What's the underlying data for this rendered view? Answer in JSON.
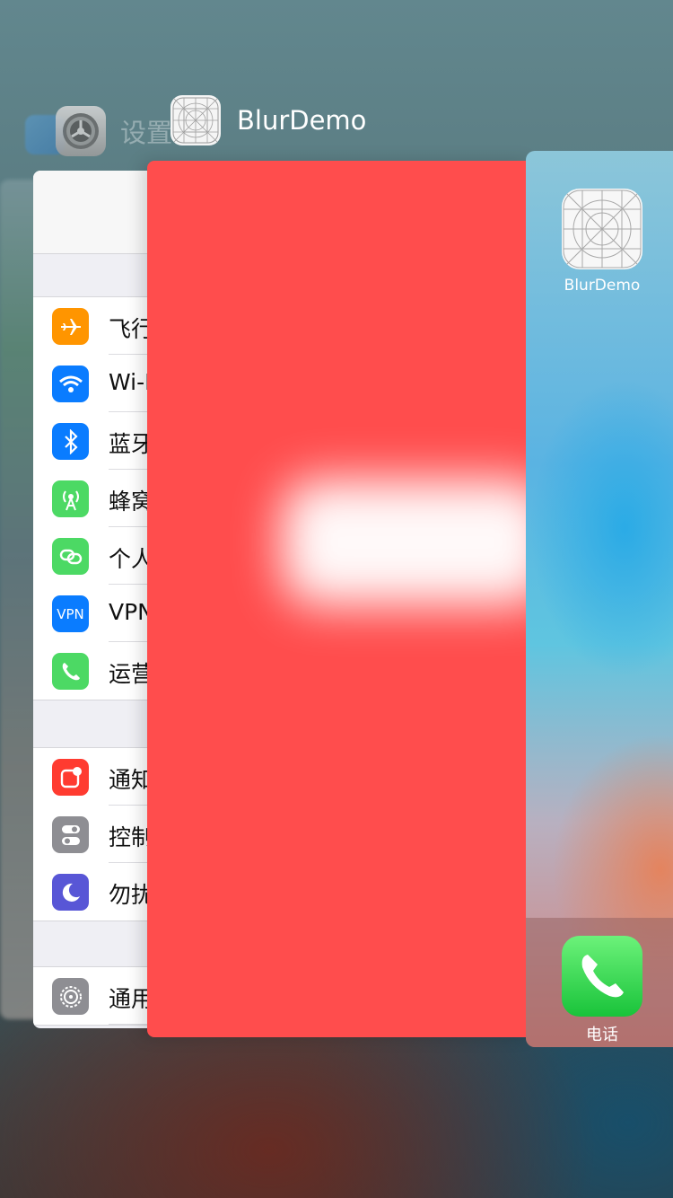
{
  "switcher": {
    "settings_card": {
      "app_name": "设置",
      "rows_group1": [
        {
          "label": "飞行",
          "icon": "airplane-icon",
          "color": "#ff9500"
        },
        {
          "label": "Wi-F",
          "icon": "wifi-icon",
          "color": "#0a7cff"
        },
        {
          "label": "蓝牙",
          "icon": "bluetooth-icon",
          "color": "#0a7cff"
        },
        {
          "label": "蜂窝",
          "icon": "cellular-icon",
          "color": "#4cd964"
        },
        {
          "label": "个人",
          "icon": "hotspot-icon",
          "color": "#4cd964"
        },
        {
          "label": "VPN",
          "icon": "vpn-icon",
          "icon_text": "VPN",
          "color": "#0a7cff"
        },
        {
          "label": "运营",
          "icon": "phone-icon",
          "color": "#4cd964"
        }
      ],
      "rows_group2": [
        {
          "label": "通知",
          "icon": "notifications-icon",
          "color": "#ff3b30"
        },
        {
          "label": "控制",
          "icon": "control-center-icon",
          "color": "#8e8e93"
        },
        {
          "label": "勿扰",
          "icon": "moon-icon",
          "color": "#5856d6"
        }
      ],
      "rows_group3": [
        {
          "label": "通用",
          "icon": "gear-icon",
          "color": "#8e8e93"
        }
      ]
    },
    "blurdemo_card": {
      "app_name": "BlurDemo",
      "background": "#ff4d4d"
    },
    "home_card": {
      "app_label": "BlurDemo",
      "dock_label": "电话"
    }
  }
}
